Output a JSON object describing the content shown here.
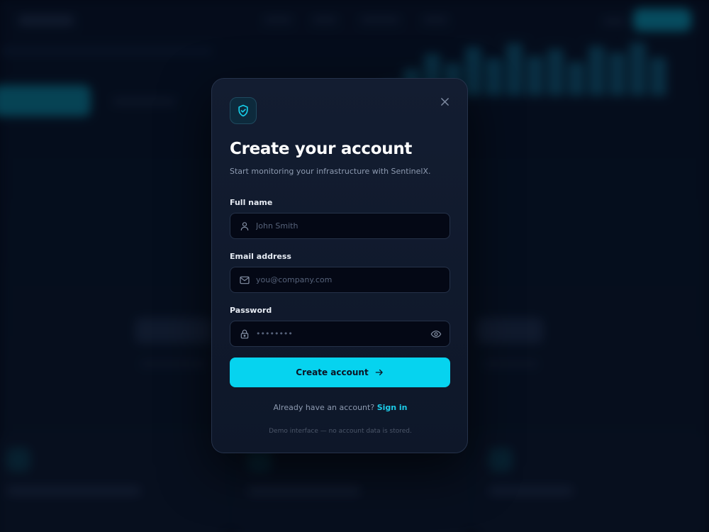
{
  "modal": {
    "title": "Create your account",
    "subtitle": "Start monitoring your infrastructure with SentinelX.",
    "brand_icon": "shield-check-icon",
    "close_icon": "close-icon"
  },
  "form": {
    "full_name": {
      "label": "Full name",
      "placeholder": "John Smith",
      "value": "",
      "icon": "user-icon"
    },
    "email": {
      "label": "Email address",
      "placeholder": "you@company.com",
      "value": "",
      "icon": "mail-icon"
    },
    "password": {
      "label": "Password",
      "placeholder": "••••••••",
      "value": "",
      "icon": "lock-icon",
      "toggle_icon": "eye-icon"
    },
    "submit_label": "Create account",
    "submit_icon": "arrow-right-icon"
  },
  "signin": {
    "prompt": "Already have an account?",
    "link": "Sign in"
  },
  "footer_note": "Demo interface — no account data is stored.",
  "colors": {
    "accent": "#06d3ef",
    "link": "#1ccbe8",
    "modal_background": "#111a2d",
    "page_background": "#050a18"
  }
}
